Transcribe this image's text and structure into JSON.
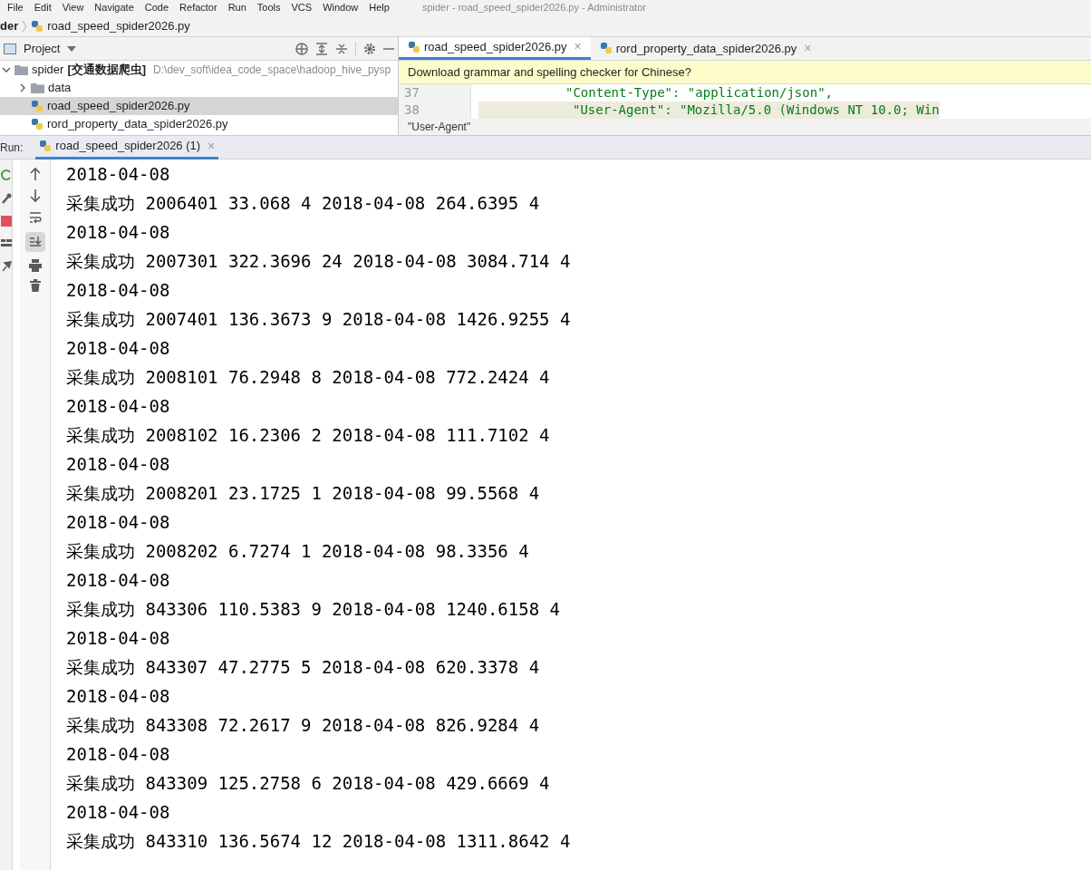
{
  "menu": [
    "File",
    "Edit",
    "View",
    "Navigate",
    "Code",
    "Refactor",
    "Run",
    "Tools",
    "VCS",
    "Window",
    "Help"
  ],
  "window": {
    "title": "spider - road_speed_spider2026.py - Administrator"
  },
  "breadcrumb": [
    "der",
    "road_speed_spider2026.py"
  ],
  "project": {
    "title": "Project",
    "tree": [
      {
        "label": "spider",
        "tag": "[交通数据爬虫]",
        "path": "D:\\dev_soft\\idea_code_space\\hadoop_hive_pysp",
        "kind": "folder",
        "expanded": true,
        "selected": false,
        "children": [
          {
            "label": "data",
            "kind": "folder",
            "expanded": false,
            "selected": false
          },
          {
            "label": "road_speed_spider2026.py",
            "kind": "python",
            "selected": true
          },
          {
            "label": "rord_property_data_spider2026.py",
            "kind": "python",
            "selected": false
          }
        ]
      }
    ]
  },
  "editor": {
    "tabs": [
      {
        "label": "road_speed_spider2026.py",
        "close": "×",
        "selected": true
      },
      {
        "label": "rord_property_data_spider2026.py",
        "close": "×",
        "selected": false
      }
    ],
    "notification": "Download grammar and spelling checker for Chinese?",
    "lines": [
      {
        "number": "37",
        "code": "\"Content-Type\": \"application/json\","
      },
      {
        "number": "38",
        "code": "\"User-Agent\": \"Mozilla/5.0 (Windows NT 10.0; Win"
      }
    ],
    "breadcrumb": "\"User-Agent\""
  },
  "run": {
    "label": "Run:",
    "tabs": [
      {
        "label": "road_speed_spider2026 (1)",
        "close": "×",
        "selected": true
      }
    ],
    "output": [
      "2018-04-08",
      "采集成功 2006401 33.068 4 2018-04-08 264.6395 4",
      "2018-04-08",
      "采集成功 2007301 322.3696 24 2018-04-08 3084.714 4",
      "2018-04-08",
      "采集成功 2007401 136.3673 9 2018-04-08 1426.9255 4",
      "2018-04-08",
      "采集成功 2008101 76.2948 8 2018-04-08 772.2424 4",
      "2018-04-08",
      "采集成功 2008102 16.2306 2 2018-04-08 111.7102 4",
      "2018-04-08",
      "采集成功 2008201 23.1725 1 2018-04-08 99.5568 4",
      "2018-04-08",
      "采集成功 2008202 6.7274 1 2018-04-08 98.3356 4",
      "2018-04-08",
      "采集成功 843306 110.5383 9 2018-04-08 1240.6158 4",
      "2018-04-08",
      "采集成功 843307 47.2775 5 2018-04-08 620.3378 4",
      "2018-04-08",
      "采集成功 843308 72.2617 9 2018-04-08 826.9284 4",
      "2018-04-08",
      "采集成功 843309 125.2758 6 2018-04-08 429.6669 4",
      "2018-04-08",
      "采集成功 843310 136.5674 12 2018-04-08 1311.8642 4"
    ]
  }
}
